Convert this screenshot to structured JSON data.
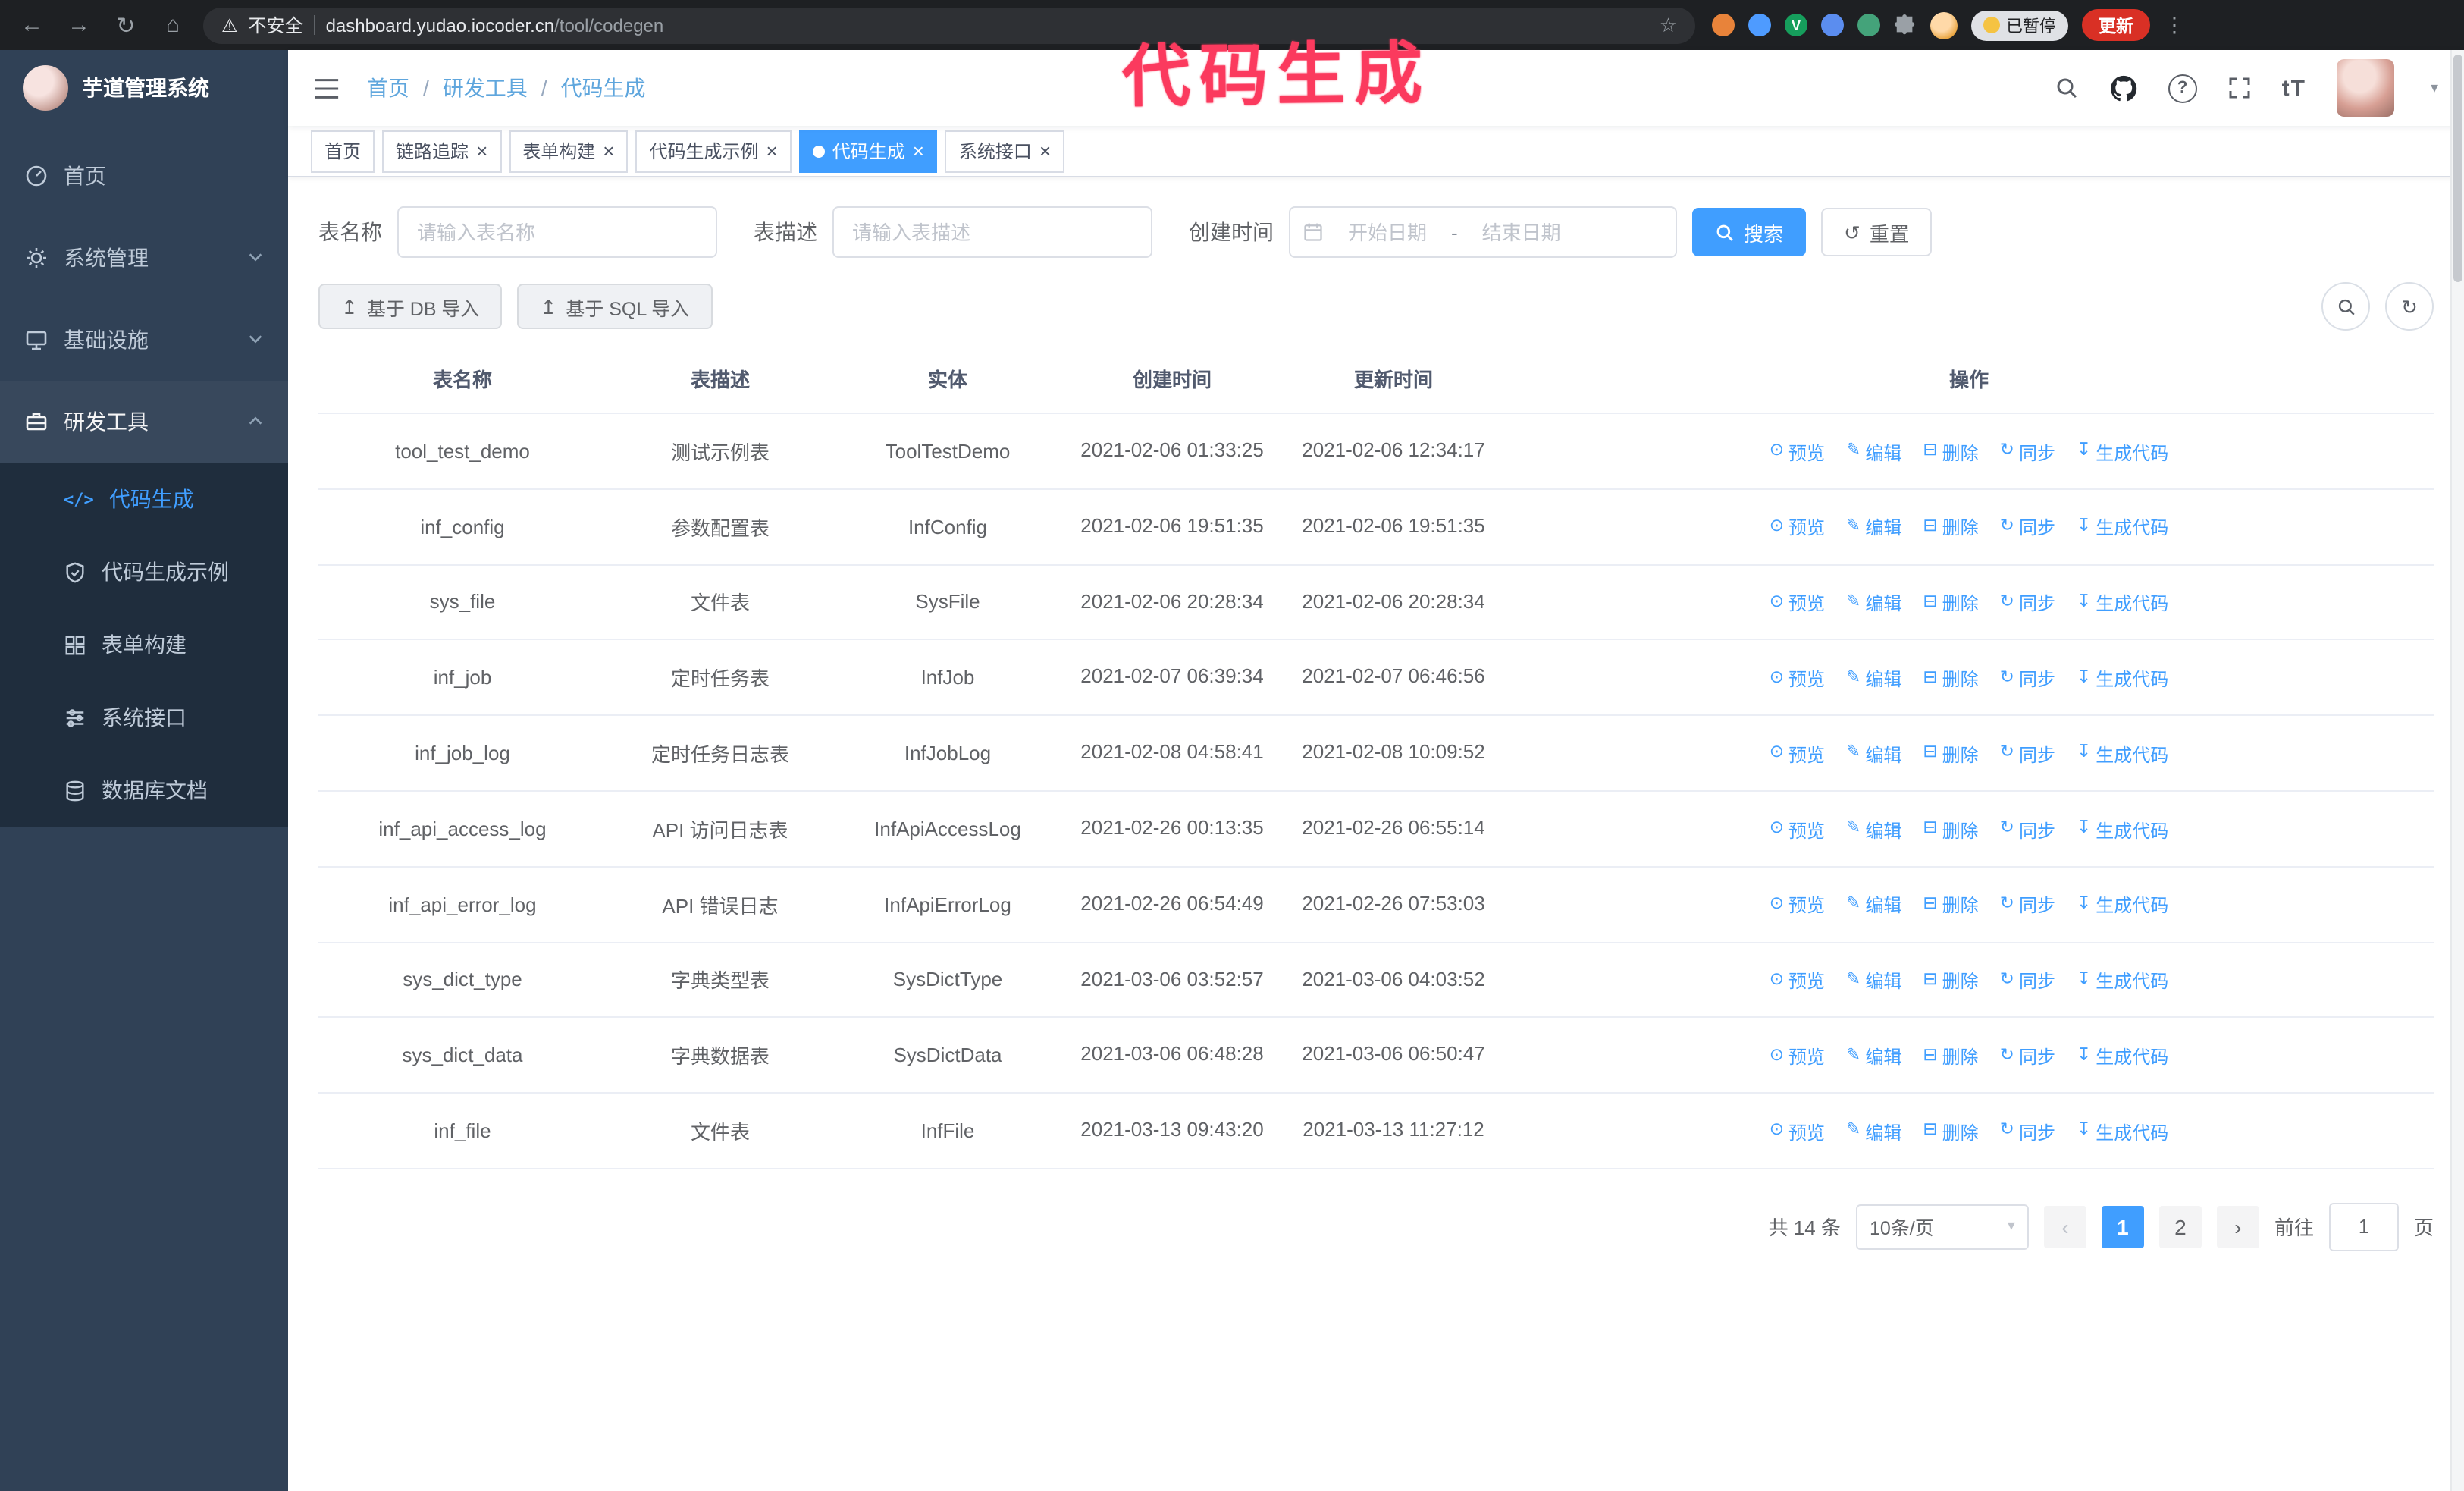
{
  "annotation": {
    "text": "代码生成",
    "color": "#fb3a5e"
  },
  "browser": {
    "security_label": "不安全",
    "url_host": "dashboard.yudao.iocoder.cn",
    "url_path": "/tool/codegen",
    "paused_badge": "已暂停",
    "update_button": "更新"
  },
  "sidebar": {
    "logo_title": "芋道管理系统",
    "items": [
      {
        "label": "首页"
      },
      {
        "label": "系统管理"
      },
      {
        "label": "基础设施"
      },
      {
        "label": "研发工具"
      }
    ],
    "submenu": [
      {
        "label": "代码生成"
      },
      {
        "label": "代码生成示例"
      },
      {
        "label": "表单构建"
      },
      {
        "label": "系统接口"
      },
      {
        "label": "数据库文档"
      }
    ]
  },
  "header": {
    "breadcrumb": [
      "首页",
      "研发工具",
      "代码生成"
    ],
    "separator": "/",
    "font_icon_label": "tT"
  },
  "tabs": [
    {
      "label": "首页"
    },
    {
      "label": "链路追踪"
    },
    {
      "label": "表单构建"
    },
    {
      "label": "代码生成示例"
    },
    {
      "label": "代码生成"
    },
    {
      "label": "系统接口"
    }
  ],
  "filters": {
    "table_name_label": "表名称",
    "table_name_placeholder": "请输入表名称",
    "table_desc_label": "表描述",
    "table_desc_placeholder": "请输入表描述",
    "create_time_label": "创建时间",
    "date_start_placeholder": "开始日期",
    "date_separator": "-",
    "date_end_placeholder": "结束日期",
    "search_button": "搜索",
    "reset_button": "重置"
  },
  "toolbar": {
    "db_import": "基于 DB 导入",
    "sql_import": "基于 SQL 导入"
  },
  "table": {
    "columns": [
      "表名称",
      "表描述",
      "实体",
      "创建时间",
      "更新时间",
      "操作"
    ],
    "actions": [
      "预览",
      "编辑",
      "删除",
      "同步",
      "生成代码"
    ],
    "rows": [
      {
        "name": "tool_test_demo",
        "desc": "测试示例表",
        "entity": "ToolTestDemo",
        "created": "2021-02-06 01:33:25",
        "updated": "2021-02-06 12:34:17"
      },
      {
        "name": "inf_config",
        "desc": "参数配置表",
        "entity": "InfConfig",
        "created": "2021-02-06 19:51:35",
        "updated": "2021-02-06 19:51:35"
      },
      {
        "name": "sys_file",
        "desc": "文件表",
        "entity": "SysFile",
        "created": "2021-02-06 20:28:34",
        "updated": "2021-02-06 20:28:34"
      },
      {
        "name": "inf_job",
        "desc": "定时任务表",
        "entity": "InfJob",
        "created": "2021-02-07 06:39:34",
        "updated": "2021-02-07 06:46:56"
      },
      {
        "name": "inf_job_log",
        "desc": "定时任务日志表",
        "entity": "InfJobLog",
        "created": "2021-02-08 04:58:41",
        "updated": "2021-02-08 10:09:52"
      },
      {
        "name": "inf_api_access_log",
        "desc": "API 访问日志表",
        "entity": "InfApiAccessLog",
        "created": "2021-02-26 00:13:35",
        "updated": "2021-02-26 06:55:14"
      },
      {
        "name": "inf_api_error_log",
        "desc": "API 错误日志",
        "entity": "InfApiErrorLog",
        "created": "2021-02-26 06:54:49",
        "updated": "2021-02-26 07:53:03"
      },
      {
        "name": "sys_dict_type",
        "desc": "字典类型表",
        "entity": "SysDictType",
        "created": "2021-03-06 03:52:57",
        "updated": "2021-03-06 04:03:52"
      },
      {
        "name": "sys_dict_data",
        "desc": "字典数据表",
        "entity": "SysDictData",
        "created": "2021-03-06 06:48:28",
        "updated": "2021-03-06 06:50:47"
      },
      {
        "name": "inf_file",
        "desc": "文件表",
        "entity": "InfFile",
        "created": "2021-03-13 09:43:20",
        "updated": "2021-03-13 11:27:12"
      }
    ]
  },
  "pagination": {
    "total": "共 14 条",
    "page_size": "10条/页",
    "page_prev": "‹",
    "page_next": "›",
    "page1": "1",
    "page2": "2",
    "goto_label": "前往",
    "goto_value": "1",
    "goto_suffix": "页"
  },
  "icons": {
    "back": "←",
    "forward": "→",
    "reload": "↻",
    "home": "⌂",
    "warning": "⚠",
    "star": "☆",
    "kebab": "⋮",
    "close": "×",
    "caret": "▾",
    "caret_small": "▾",
    "preview": "⊙",
    "edit": "✎",
    "delete": "⊟",
    "sync": "↻",
    "generate": "↧",
    "import": "↥",
    "reset": "↺",
    "refresh": "↻",
    "code": "</>",
    "question": "?",
    "ext_v": "V"
  }
}
